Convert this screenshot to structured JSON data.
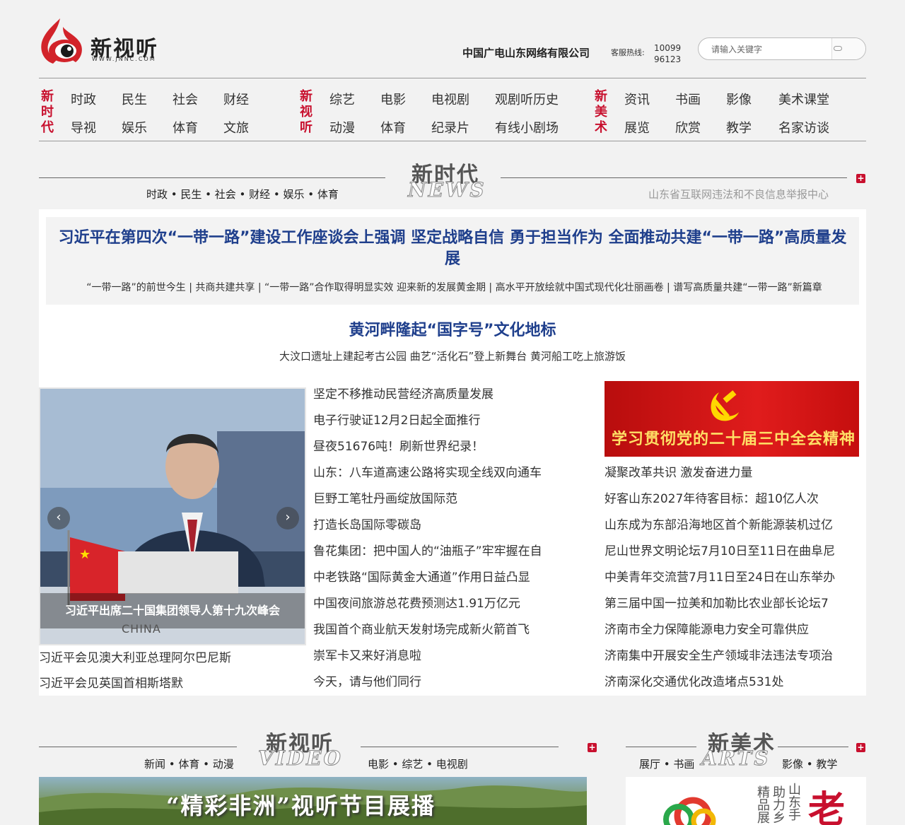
{
  "header": {
    "logo_text": "新视听",
    "logo_url_text": "WWW.JNNC.COM",
    "company": "中国广电山东网络有限公司",
    "hotline_label": "客服热线:",
    "hotline_number_1": "10099",
    "hotline_number_2": "96123",
    "search_placeholder": "请输入关键字"
  },
  "nav": {
    "groups": [
      {
        "title": "新时代",
        "row1": [
          "时政",
          "民生",
          "社会",
          "财经"
        ],
        "row2": [
          "导视",
          "娱乐",
          "体育",
          "文旅"
        ]
      },
      {
        "title": "新视听",
        "row1": [
          "综艺",
          "电影",
          "电视剧",
          "观剧听历史"
        ],
        "row2": [
          "动漫",
          "体育",
          "纪录片",
          "有线小剧场"
        ]
      },
      {
        "title": "新美术",
        "row1": [
          "资讯",
          "书画",
          "影像",
          "美术课堂"
        ],
        "row2": [
          "展览",
          "欣赏",
          "教学",
          "名家访谈"
        ]
      }
    ]
  },
  "news_section": {
    "title": "新时代",
    "subtitle": "NEWS",
    "categories": "时政 • 民生 • 社会 • 财经 • 娱乐 • 体育",
    "report_link": "山东省互联网违法和不良信息举报中心",
    "headline": "习近平在第四次“一带一路”建设工作座谈会上强调 坚定战略自信 勇于担当作为 全面推动共建“一带一路”高质量发展",
    "subline": "“一带一路”的前世今生 | 共商共建共享 | “一带一路”合作取得明显实效 迎来新的发展黄金期 | 高水平开放绘就中国式现代化壮丽画卷 | 谱写高质量共建“一带一路”新篇章",
    "headline2": "黄河畔隆起“国字号”文化地标",
    "subline2": "大汶口遗址上建起考古公园 曲艺“活化石”登上新舞台 黄河船工吃上旅游饭",
    "slider_caption": "习近平出席二十国集团领导人第十九次峰会",
    "slider_flag_text": "CHINA",
    "left_list": [
      "习近平会见澳大利亚总理阿尔巴尼斯",
      "习近平会见英国首相斯塔默"
    ],
    "middle_list": [
      "坚定不移推动民营经济高质量发展",
      "电子行驶证12月2日起全面推行",
      "昼夜51676吨！刷新世界纪录！",
      "山东：八车道高速公路将实现全线双向通车",
      "巨野工笔牡丹画绽放国际范",
      "打造长岛国际零碳岛",
      "鲁花集团：把中国人的“油瓶子”牢牢握在自",
      "中老铁路“国际黄金大通道”作用日益凸显",
      "中国夜间旅游总花费预测达1.91万亿元",
      "我国首个商业航天发射场完成新火箭首飞",
      "崇军卡又来好消息啦",
      "今天，请与他们同行"
    ],
    "banner_text": "学习贯彻党的二十届三中全会精神",
    "right_list": [
      "凝聚改革共识 激发奋进力量",
      "好客山东2027年待客目标：超10亿人次",
      "山东成为东部沿海地区首个新能源装机过亿",
      "尼山世界文明论坛7月10日至11日在曲阜尼",
      "中美青年交流营7月11日至24日在山东举办",
      "第三届中国一拉美和加勒比农业部长论坛7",
      "济南市全力保障能源电力安全可靠供应",
      "济南集中开展安全生产领域非法违法专项治",
      "济南深化交通优化改造堵点531处"
    ]
  },
  "video_section": {
    "title": "新视听",
    "subtitle": "VIDEO",
    "cats_left": "新闻 • 体育 • 动漫",
    "cats_right": "电影 • 综艺 • 电视剧",
    "banner_title": "“精彩非洲”视听节目展播"
  },
  "arts_section": {
    "title": "新美术",
    "subtitle": "ARTS",
    "cats_left": "展厅 • 书画",
    "cats_right": "影像 • 教学",
    "poster_text_1": "山东手",
    "poster_text_2": "助力乡",
    "poster_text_3": "精品展",
    "poster_big_char": "老"
  },
  "colors": {
    "accent_red": "#c8102e",
    "headline_blue": "#1f3f8c"
  }
}
